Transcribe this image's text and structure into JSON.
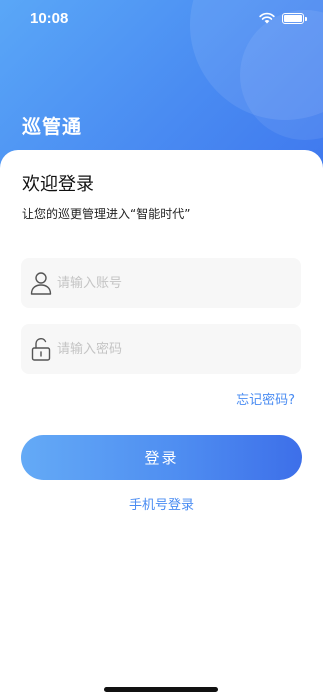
{
  "status_bar": {
    "time": "10:08"
  },
  "app": {
    "title": "巡管通"
  },
  "login": {
    "welcome_title": "欢迎登录",
    "welcome_subtitle": "让您的巡更管理进入“智能时代”",
    "account_placeholder": "请输入账号",
    "password_placeholder": "请输入密码",
    "forgot_password": "忘记密码?",
    "login_button": "登录",
    "phone_login": "手机号登录"
  },
  "colors": {
    "accent": "#4a8cf2",
    "header_gradient_start": "#5aa7f7",
    "header_gradient_end": "#3f78ee"
  }
}
